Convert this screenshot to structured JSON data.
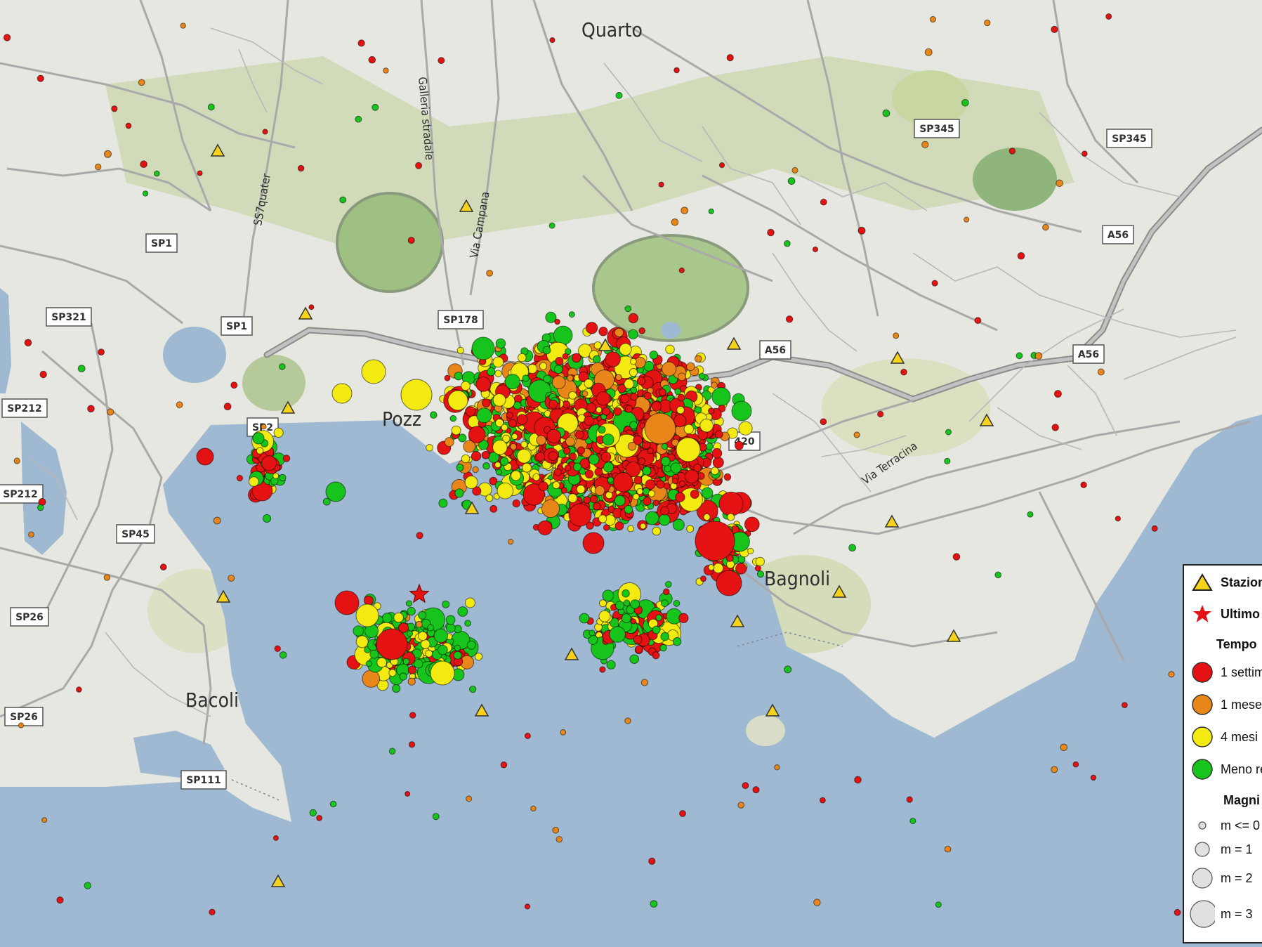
{
  "places": {
    "quarto": "Quarto",
    "pozzuoli": "Pozz",
    "bagnoli": "Bagnoli",
    "bacoli": "Bacoli",
    "galleria": "Galleria stradale",
    "via_campana": "Via Campana",
    "via_terracina": "Via Terracina",
    "ss7": "SS7quater"
  },
  "roads": [
    "SP1",
    "SP1",
    "SP321",
    "SP178",
    "SP212",
    "SP212",
    "SP2",
    "SP45",
    "SP26",
    "SP26",
    "SP111",
    "SP345",
    "SP345",
    "A56",
    "A56",
    "A56",
    "420"
  ],
  "legend": {
    "stazione": "Stazion",
    "ultimo": "Ultimo",
    "tempo_title": "Tempo",
    "t1": "1 settim",
    "t2": "1 mese",
    "t3": "4 mesi",
    "t4": "Meno re",
    "magn_title": "Magni",
    "m0": "m <= 0",
    "m1": "m = 1",
    "m2": "m = 2",
    "m3": "m = 3"
  },
  "colors": {
    "red": "#e41212",
    "orange": "#e8861a",
    "yellow": "#f2ea10",
    "green": "#16c41c",
    "sea": "#9fb9d3",
    "land": "#e6e7e0",
    "station": "#f5d31a"
  },
  "icons": {
    "station": "triangle-station-icon",
    "last_event": "star-last-event-icon"
  }
}
